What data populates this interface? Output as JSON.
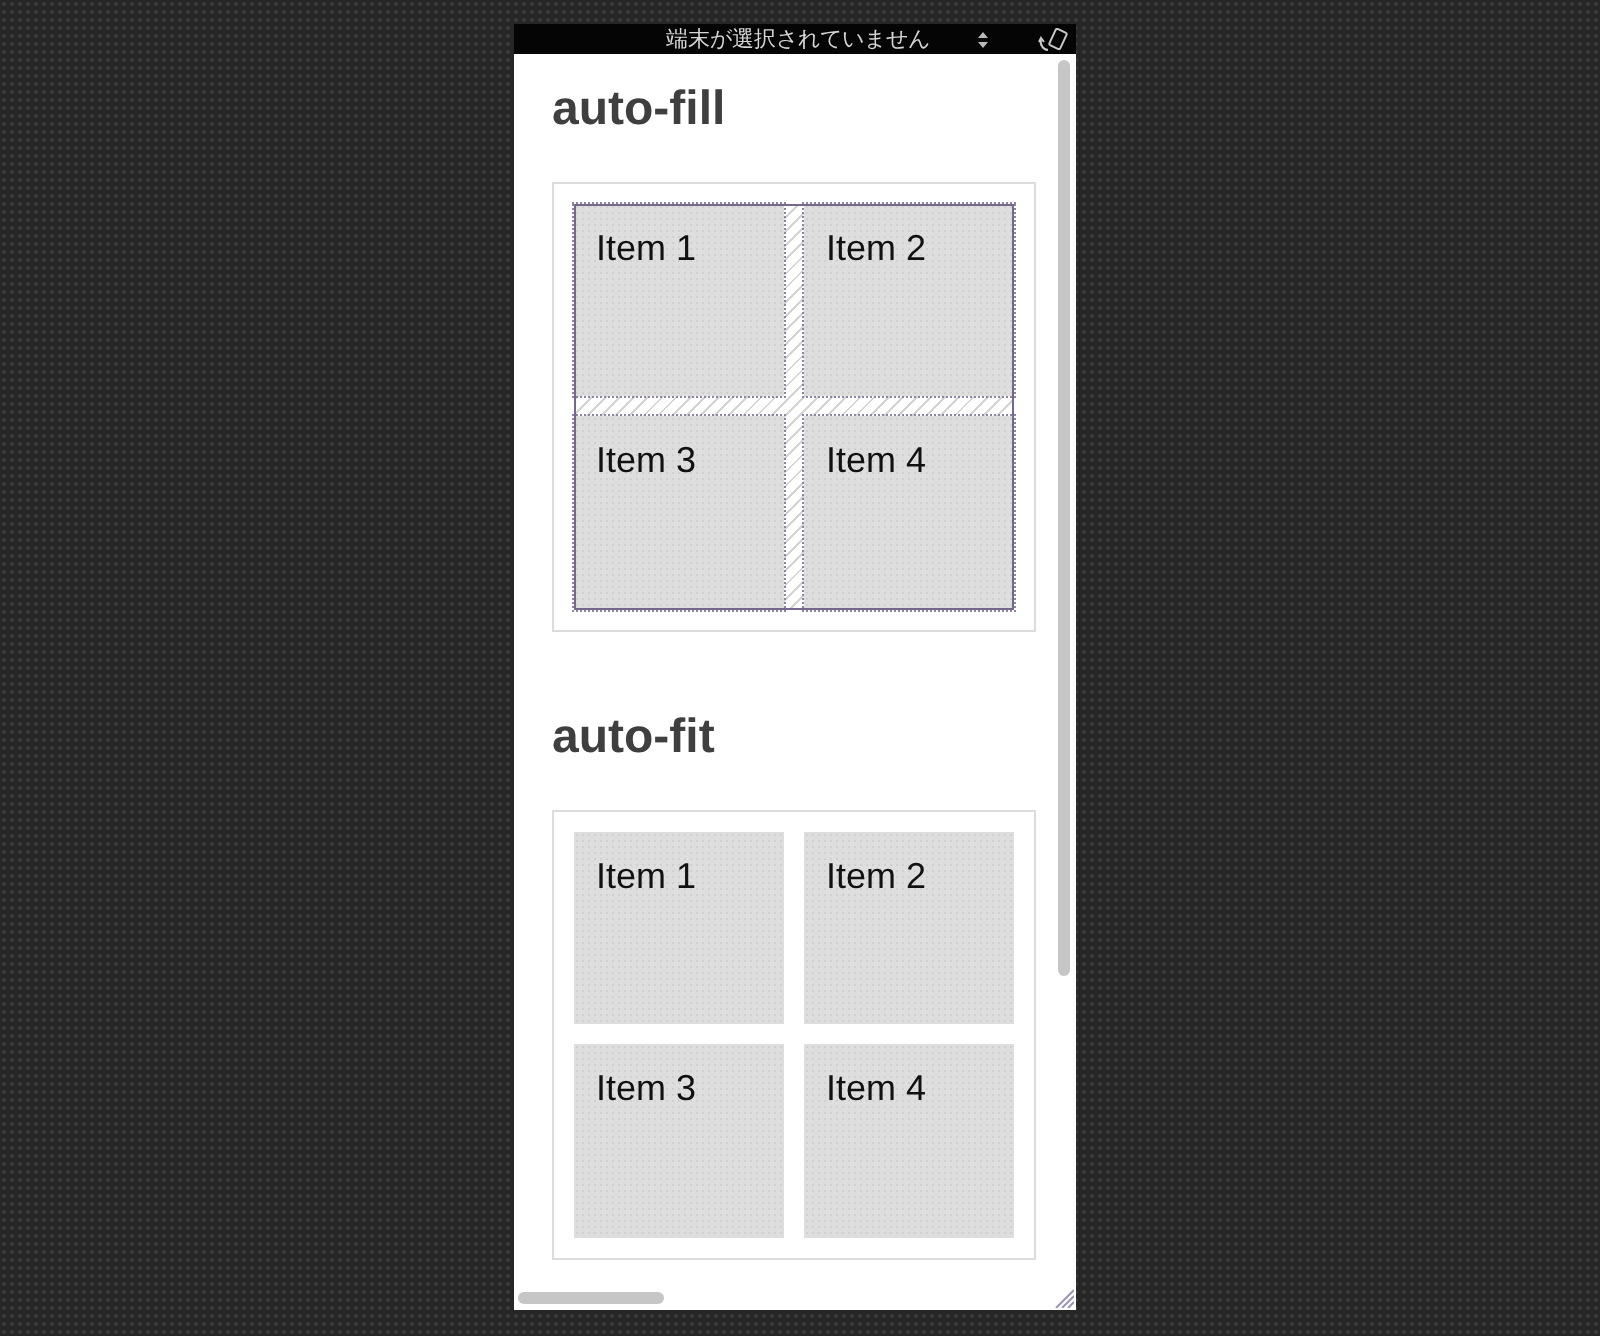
{
  "device_bar": {
    "device_select": "端末が選択されていません"
  },
  "sections": [
    {
      "title": "auto-fill",
      "grid_overlay": true,
      "items": [
        "Item 1",
        "Item 2",
        "Item 3",
        "Item 4"
      ]
    },
    {
      "title": "auto-fit",
      "grid_overlay": false,
      "items": [
        "Item 1",
        "Item 2",
        "Item 3",
        "Item 4"
      ]
    }
  ]
}
